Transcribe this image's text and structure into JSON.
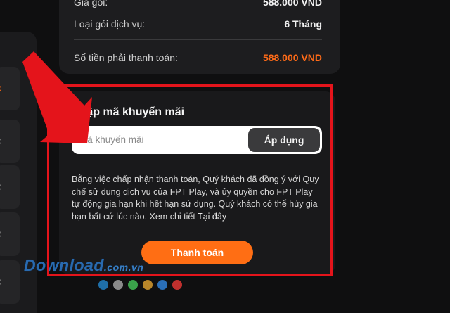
{
  "summary": {
    "price_label": "Giá gói:",
    "price_value": "588.000 VND",
    "package_type_label": "Loại gói dịch vụ:",
    "package_type_value": "6 Tháng",
    "total_label": "Số tiền phải thanh toán:",
    "total_value": "588.000 VND"
  },
  "promo": {
    "title": "Nhập mã khuyến mãi",
    "input_placeholder": "Mã khuyến mãi",
    "apply_button": "Áp dụng"
  },
  "terms": {
    "text": "Bằng việc chấp nhận thanh toán, Quý khách đã đồng ý với Quy chế sử dụng dịch vụ của FPT Play, và ủy quyền cho FPT Play tự động gia hạn khi hết hạn sử dụng. Quý khách có thể hủy gia hạn bất cứ lúc nào. Xem chi tiết ",
    "link": "Tại đây"
  },
  "pay_button": "Thanh toán",
  "watermark": {
    "main": "Download",
    "suffix": ".com.vn"
  },
  "colors": {
    "accent": "#ff6e14",
    "annotation_red": "#e4141b",
    "dots": [
      "#1f6fa8",
      "#8a8a8a",
      "#3aa24a",
      "#b8862a",
      "#2a6fb8",
      "#c0302e"
    ]
  }
}
